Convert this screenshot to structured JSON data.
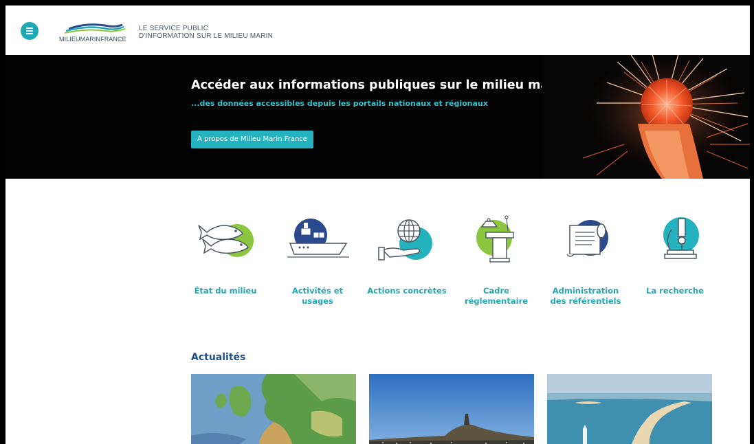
{
  "header": {
    "logo_text": "MILIEUMARINFRANCE",
    "tagline_line1": "LE SERVICE PUBLIC",
    "tagline_line2": "D'INFORMATION SUR LE MILIEU MARIN",
    "menu_icon": "hamburger-menu-icon"
  },
  "hero": {
    "title": "Accéder aux informations publiques sur le milieu marin",
    "subtitle": "...des données accessibles depuis les portails nationaux et régionaux",
    "button_label": "À propos de Milieu Marin France"
  },
  "categories": [
    {
      "label": "État du milieu",
      "icon": "fish-icon"
    },
    {
      "label": "Activités et usages",
      "icon": "cargo-ship-icon"
    },
    {
      "label": "Actions concrètes",
      "icon": "globe-in-hand-icon"
    },
    {
      "label": "Cadre réglementaire",
      "icon": "lectern-icon"
    },
    {
      "label": "Administration des référentiels",
      "icon": "scroll-document-icon"
    },
    {
      "label": "La recherche",
      "icon": "microscope-icon"
    }
  ],
  "news": {
    "title": "Actualités"
  },
  "colors": {
    "accent": "#25b2bf",
    "news_title": "#1d4f8a",
    "green": "#8cc63f",
    "navy": "#2b4a8e"
  }
}
